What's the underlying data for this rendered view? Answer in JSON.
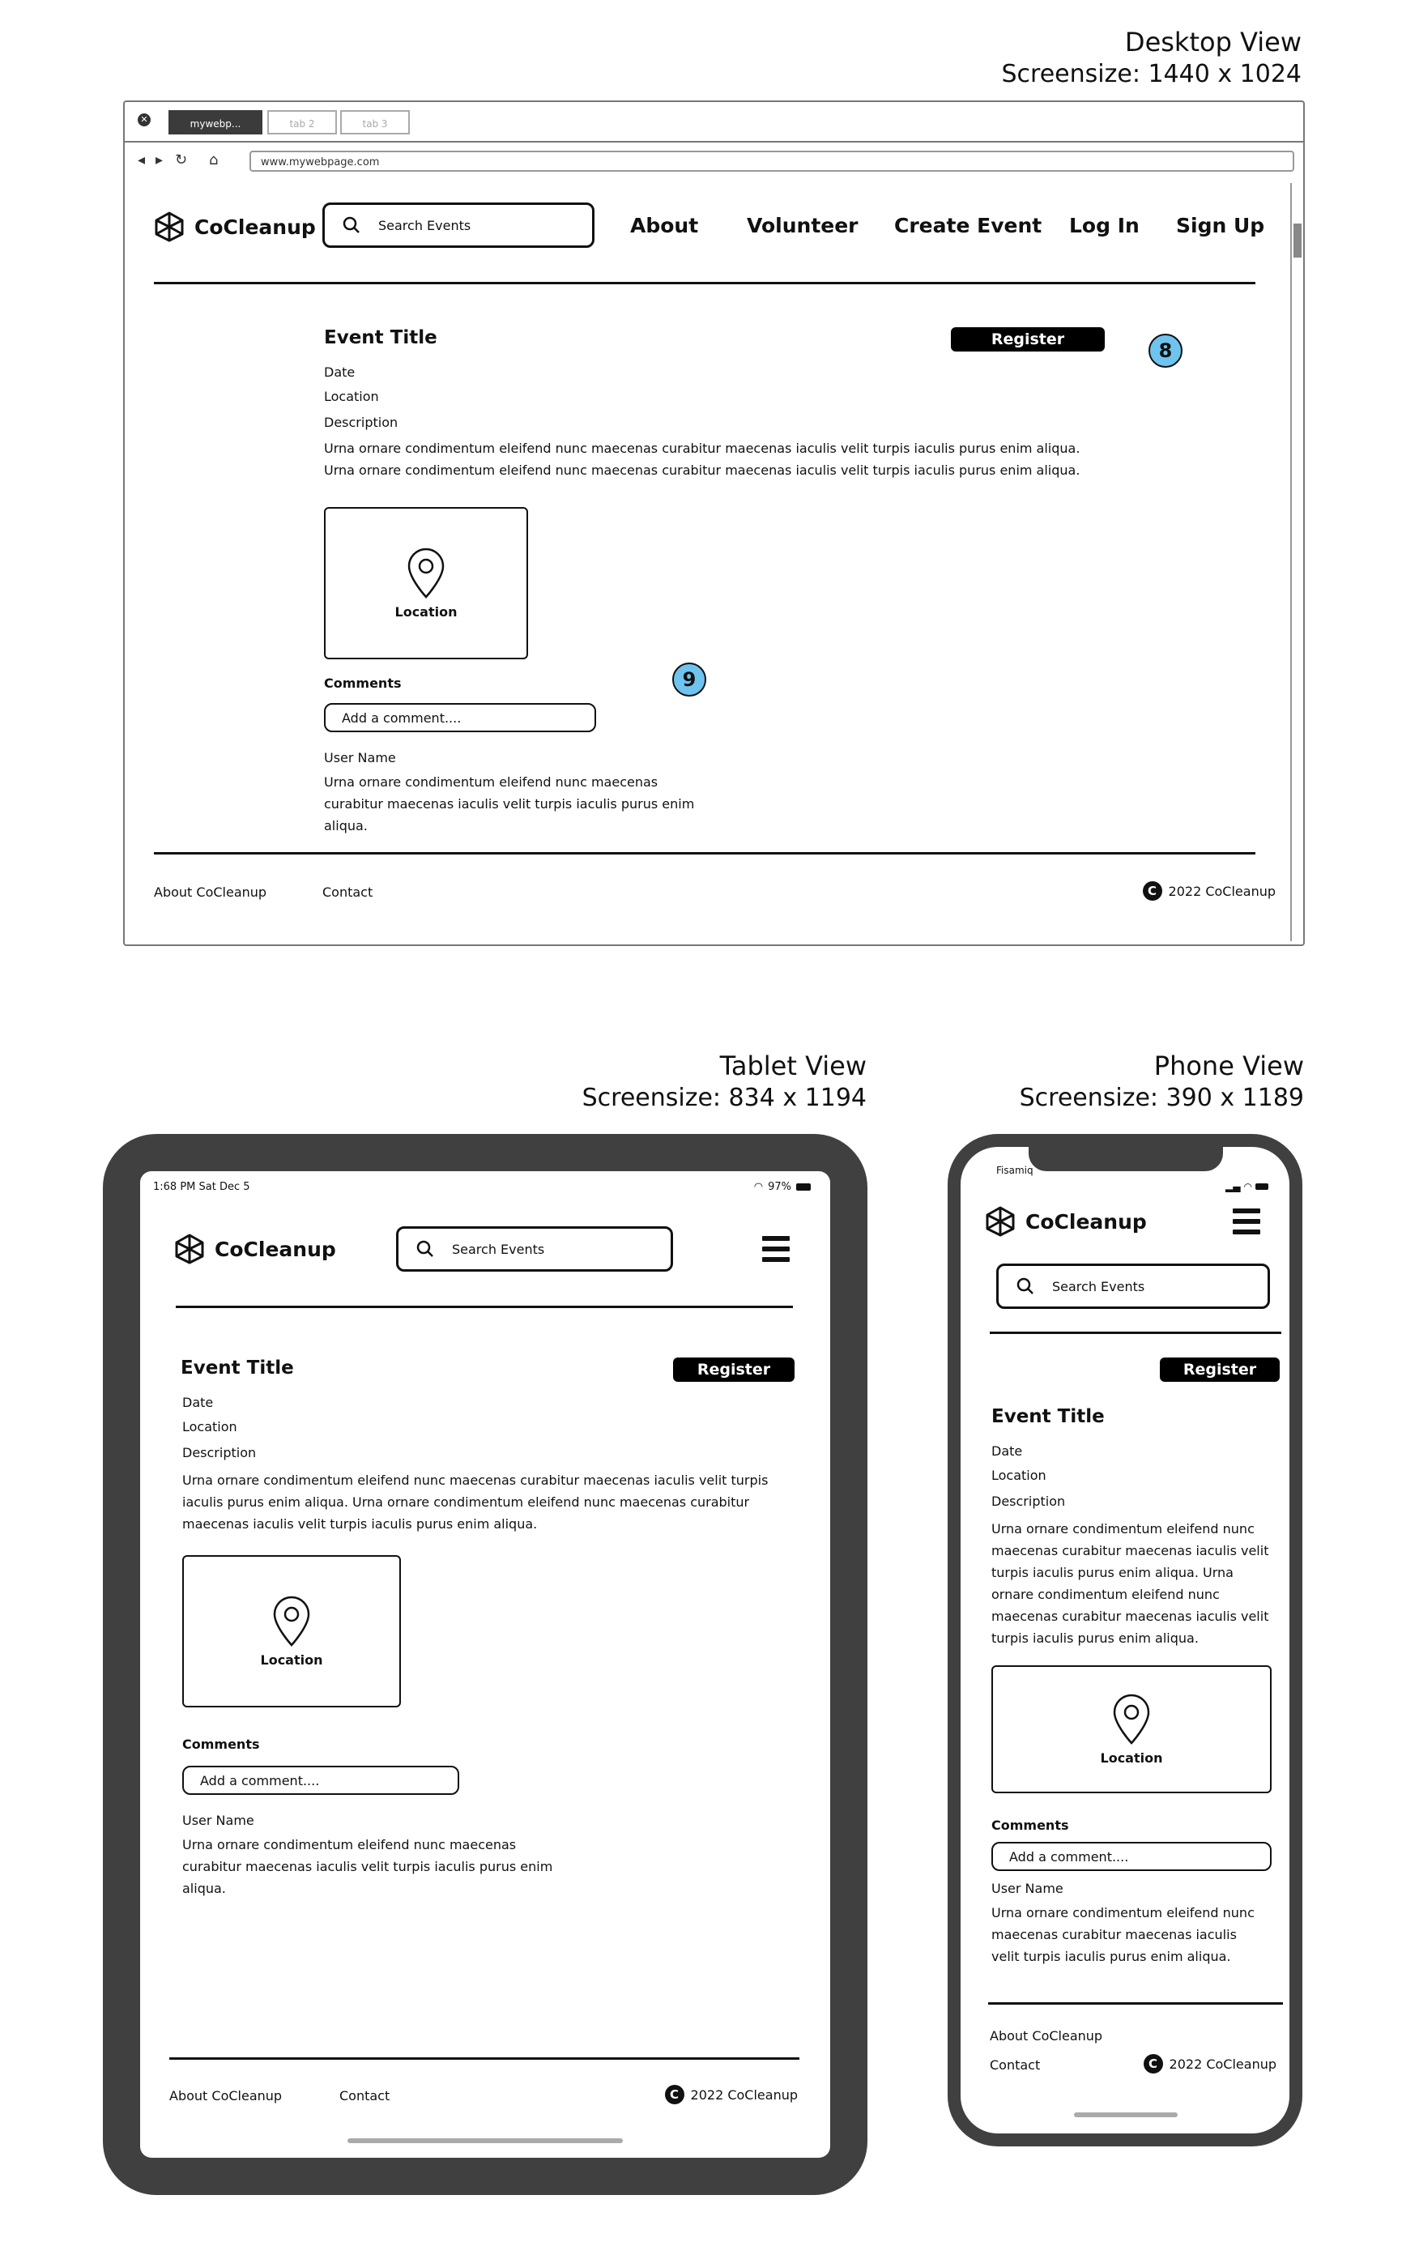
{
  "desktop": {
    "view_title": "Desktop View",
    "screensize": "Screensize: 1440 x 1024",
    "browser": {
      "tabs": [
        "mywebp...",
        "tab 2",
        "tab 3"
      ],
      "url": "www.mywebpage.com"
    },
    "logo_text": "CoCleanup",
    "search_placeholder": "Search Events",
    "nav": [
      "About",
      "Volunteer",
      "Create Event",
      "Log In",
      "Sign Up"
    ],
    "event": {
      "title": "Event Title",
      "date": "Date",
      "location": "Location",
      "description_label": "Description",
      "description": "Urna ornare condimentum eleifend nunc maecenas curabitur maecenas iaculis velit turpis iaculis purus enim aliqua. Urna ornare condimentum eleifend nunc maecenas curabitur maecenas iaculis velit turpis iaculis purus enim aliqua.",
      "register_label": "Register",
      "map_label": "Location"
    },
    "comments": {
      "label": "Comments",
      "placeholder": "Add a comment....",
      "user_name": "User Name",
      "text": "Urna ornare condimentum eleifend nunc maecenas curabitur maecenas iaculis velit turpis iaculis purus enim aliqua."
    },
    "badges": [
      "8",
      "9"
    ],
    "footer": {
      "about": "About CoCleanup",
      "contact": "Contact",
      "copyright": "2022 CoCleanup"
    }
  },
  "tablet": {
    "view_title": "Tablet View",
    "screensize": "Screensize: 834 x 1194",
    "status_time": "1:68 PM   Sat Dec 5",
    "status_battery": "97%",
    "logo_text": "CoCleanup",
    "search_placeholder": "Search Events",
    "event": {
      "title": "Event Title",
      "date": "Date",
      "location": "Location",
      "description_label": "Description",
      "description": "Urna ornare condimentum eleifend nunc maecenas curabitur maecenas iaculis velit turpis iaculis purus enim aliqua. Urna ornare condimentum eleifend nunc maecenas curabitur maecenas iaculis velit turpis iaculis purus enim aliqua.",
      "register_label": "Register",
      "map_label": "Location"
    },
    "comments": {
      "label": "Comments",
      "placeholder": "Add a comment....",
      "user_name": "User Name",
      "text": "Urna ornare condimentum eleifend nunc maecenas curabitur maecenas iaculis velit turpis iaculis purus enim aliqua."
    },
    "footer": {
      "about": "About CoCleanup",
      "contact": "Contact",
      "copyright": "2022 CoCleanup"
    }
  },
  "phone": {
    "view_title": "Phone View",
    "screensize": "Screensize: 390 x 1189",
    "carrier": "Fisamiq",
    "logo_text": "CoCleanup",
    "search_placeholder": "Search Events",
    "event": {
      "title": "Event Title",
      "date": "Date",
      "location": "Location",
      "description_label": "Description",
      "description": "Urna ornare condimentum eleifend nunc maecenas curabitur maecenas iaculis velit turpis iaculis purus enim aliqua. Urna ornare condimentum eleifend nunc maecenas curabitur maecenas iaculis velit turpis iaculis purus enim aliqua.",
      "register_label": "Register",
      "map_label": "Location"
    },
    "comments": {
      "label": "Comments",
      "placeholder": "Add a comment....",
      "user_name": "User Name",
      "text": "Urna ornare condimentum eleifend nunc maecenas curabitur maecenas iaculis velit turpis iaculis purus enim aliqua."
    },
    "footer": {
      "about": "About CoCleanup",
      "contact": "Contact",
      "copyright": "2022 CoCleanup"
    }
  }
}
